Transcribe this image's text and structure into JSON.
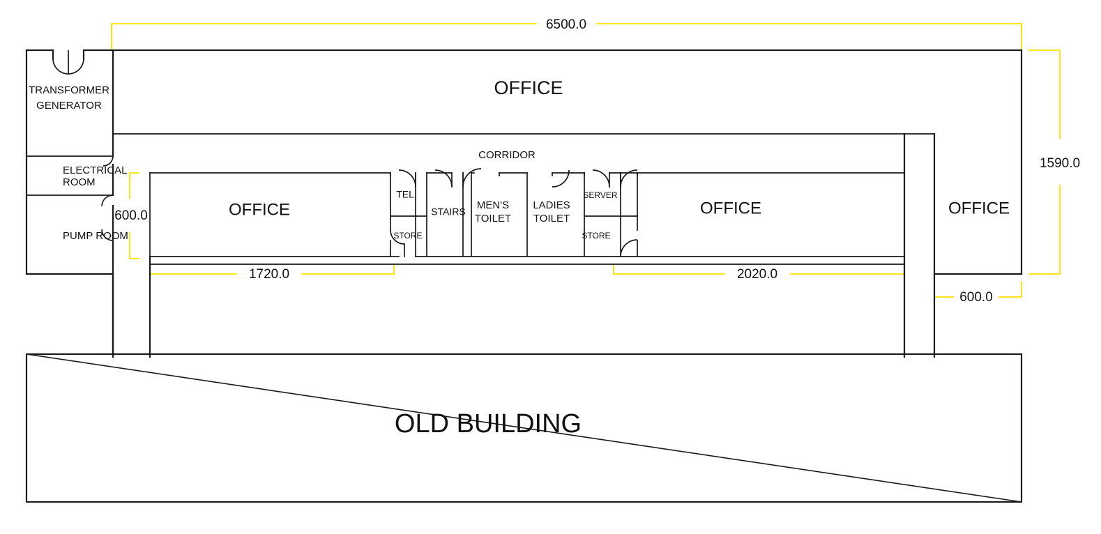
{
  "drawing": {
    "title": "OLD BUILDING",
    "colors": {
      "wall": "#1a1a1a",
      "dimension": "#ffe000",
      "text": "#111111",
      "background": "#ffffff"
    }
  },
  "rooms": {
    "transformer_generator": {
      "line1": "TRANSFORMER",
      "line2": "GENERATOR"
    },
    "electrical_room": {
      "line1": "ELECTRICAL",
      "line2": "ROOM"
    },
    "pump_room": {
      "line1": "PUMP ROOM"
    },
    "office_top": {
      "line1": "OFFICE"
    },
    "corridor": {
      "line1": "CORRIDOR"
    },
    "office_left": {
      "line1": "OFFICE"
    },
    "tel": {
      "line1": "TEL."
    },
    "store_left": {
      "line1": "STORE"
    },
    "stairs": {
      "line1": "STAIRS"
    },
    "mens_toilet": {
      "line1": "MEN'S",
      "line2": "TOILET"
    },
    "ladies_toilet": {
      "line1": "LADIES",
      "line2": "TOILET"
    },
    "server": {
      "line1": "SERVER"
    },
    "store_right": {
      "line1": "STORE"
    },
    "office_center_right": {
      "line1": "OFFICE"
    },
    "office_right": {
      "line1": "OFFICE"
    },
    "old_building": {
      "line1": "OLD BUILDING"
    }
  },
  "dimensions": {
    "overall_width": "6500.0",
    "overall_height": "1590.0",
    "left_bay_width": "600.0",
    "office_left_width": "1720.0",
    "office_center_right_width": "2020.0",
    "office_right_width": "600.0"
  }
}
